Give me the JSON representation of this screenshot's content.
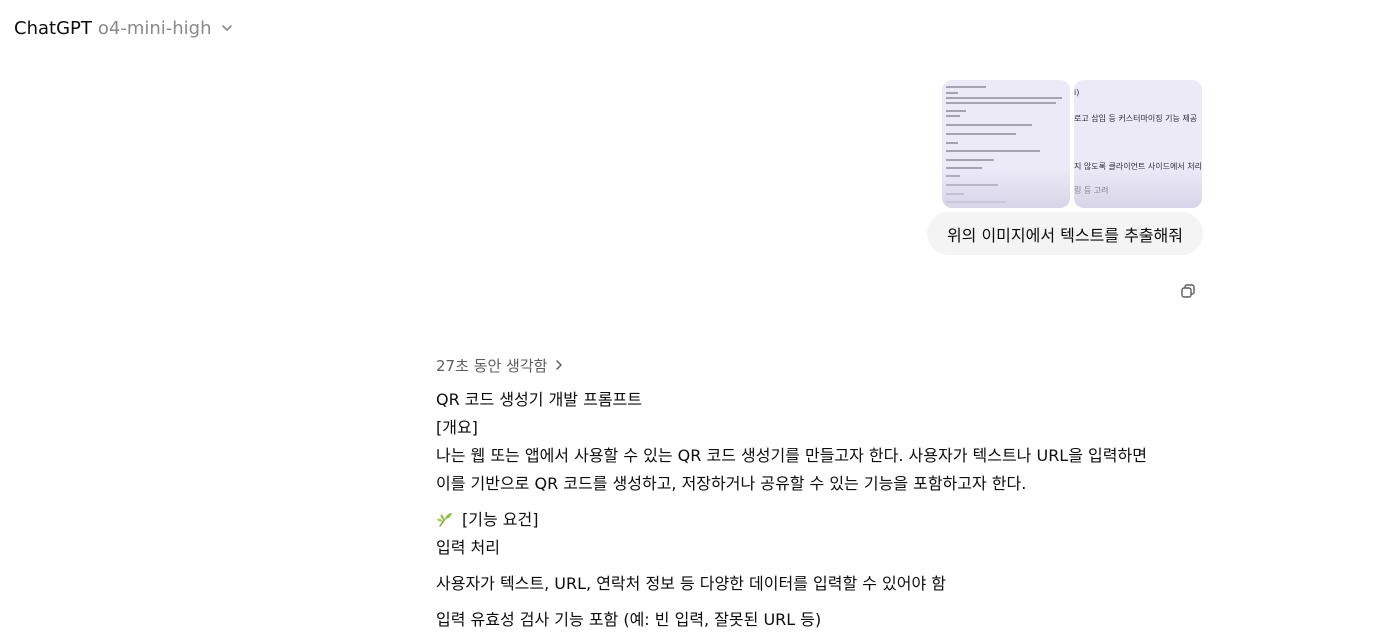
{
  "header": {
    "app_name": "ChatGPT",
    "model_name": "o4-mini-high",
    "chevron_icon": "chevron-down-icon"
  },
  "user_message": {
    "attachments": [
      {
        "name": "image-attachment-1"
      },
      {
        "name": "image-attachment-2",
        "visible_lines": [
          "i)",
          "로고 삽입 등 커스터마이징 기능 제공",
          "지 않도록 클라이언트 사이드에서 처리",
          "링 등 고려"
        ]
      }
    ],
    "text": "위의 이미지에서 텍스트를 추출해줘",
    "copy_icon": "copy-icon"
  },
  "assistant_message": {
    "thought_label": "27초 동안 생각함",
    "lines": {
      "title": "QR 코드 생성기 개발 프롬프트",
      "overview_heading": "[개요]",
      "overview_body_1": "나는 웹 또는 앱에서 사용할 수 있는 QR 코드 생성기를 만들고자 한다. 사용자가 텍스트나 URL을 입력하면",
      "overview_body_2": "이를 기반으로 QR 코드를 생성하고, 저장하거나 공유할 수 있는 기능을 포함하고자 한다.",
      "features_heading": "[기능 요건]",
      "input_heading": "입력 처리",
      "input_item_1": "사용자가 텍스트, URL, 연락처 정보 등 다양한 데이터를 입력할 수 있어야 함",
      "input_item_2": "입력 유효성 검사 기능 포함 (예: 빈 입력, 잘못된 URL 등)"
    },
    "sprout_icon": "sprout-icon"
  }
}
